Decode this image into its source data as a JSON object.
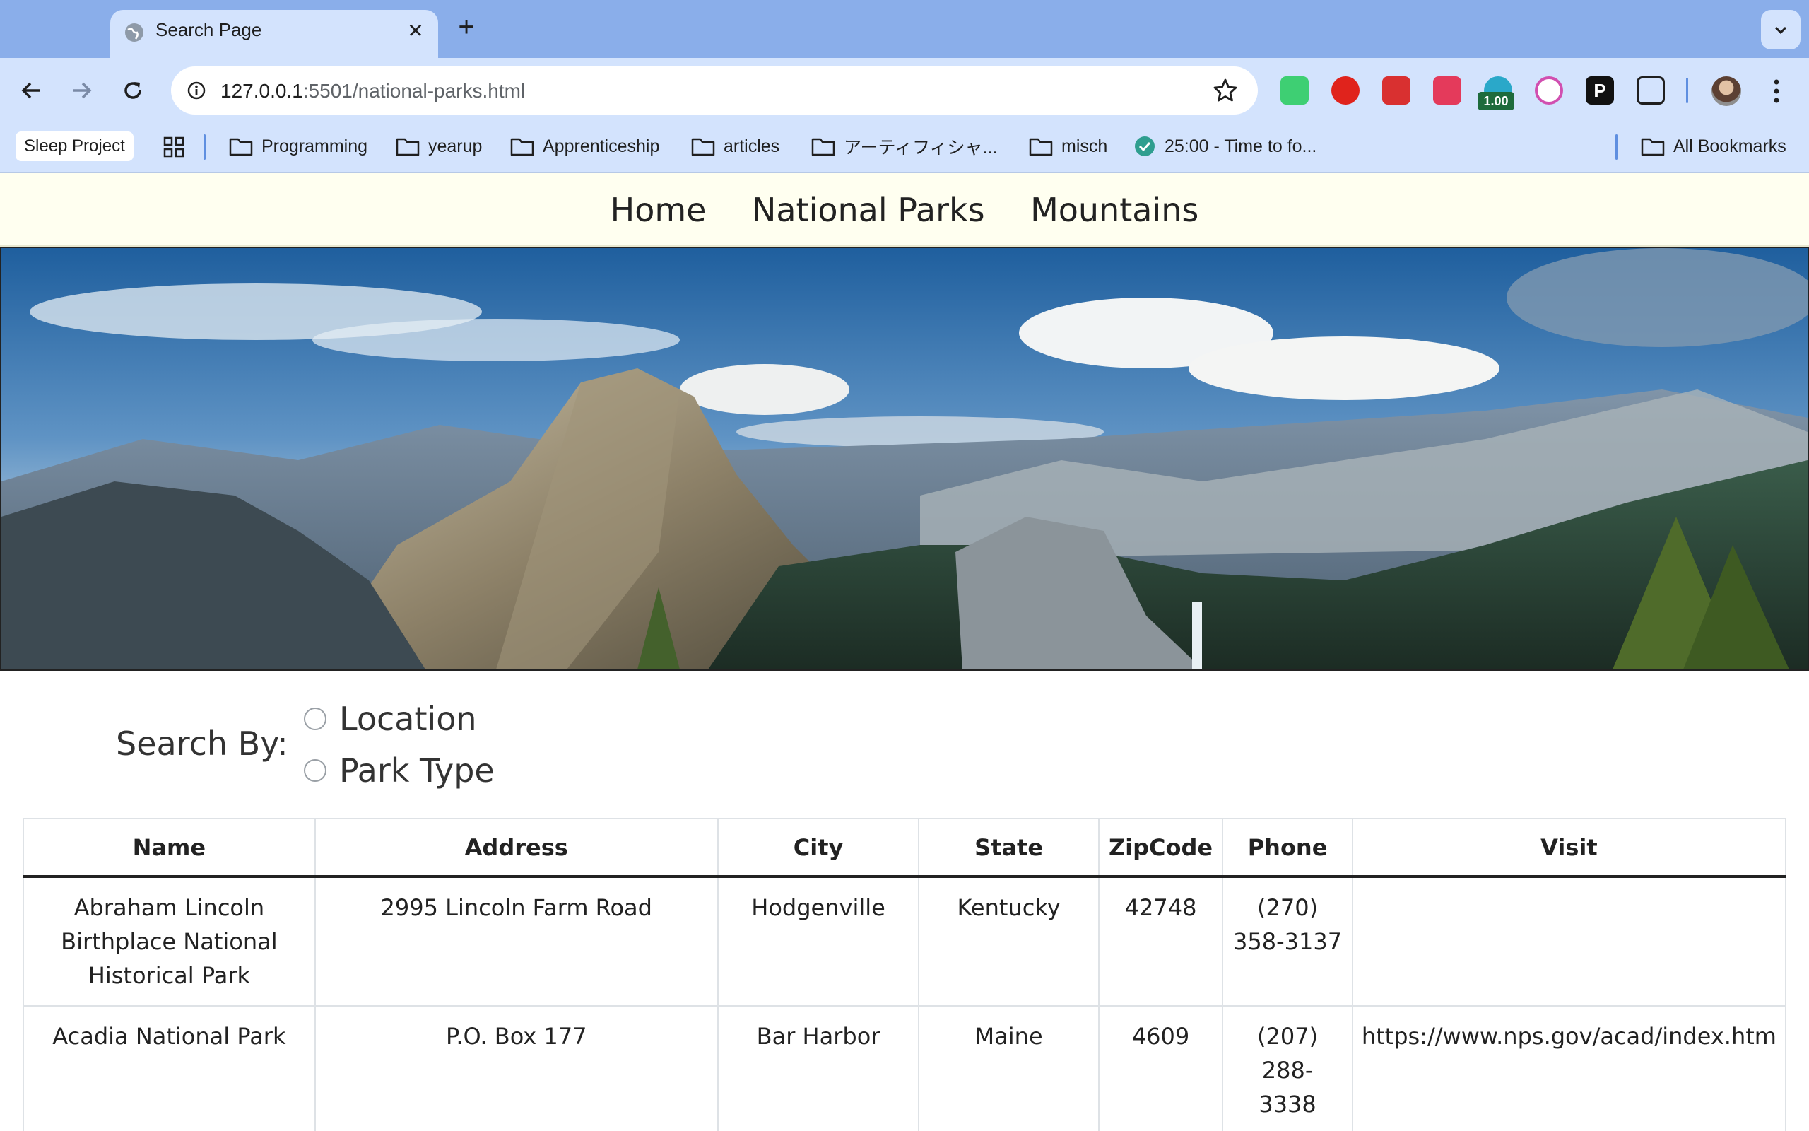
{
  "browser": {
    "tab_title": "Search Page",
    "url_host": "127.0.0.1",
    "url_path": ":5501/national-parks.html",
    "extension_badge": "1.00",
    "bookmarks": {
      "chip": "Sleep Project",
      "items": [
        "Programming",
        "yearup",
        "Apprenticeship",
        "articles",
        "アーティフィシャ...",
        "misch",
        "25:00 - Time to fo..."
      ],
      "all": "All Bookmarks"
    }
  },
  "site": {
    "nav": [
      "Home",
      "National Parks",
      "Mountains"
    ],
    "search_label": "Search By:",
    "search_options": [
      "Location",
      "Park Type"
    ]
  },
  "table": {
    "headers": [
      "Name",
      "Address",
      "City",
      "State",
      "ZipCode",
      "Phone",
      "Visit"
    ],
    "rows": [
      {
        "name": "Abraham Lincoln Birthplace National Historical Park",
        "address": "2995 Lincoln Farm Road",
        "city": "Hodgenville",
        "state": "Kentucky",
        "zip": "42748",
        "phone": "(270) 358-3137",
        "visit": ""
      },
      {
        "name": "Acadia National Park",
        "address": "P.O. Box 177",
        "city": "Bar Harbor",
        "state": "Maine",
        "zip": "4609",
        "phone": "(207) 288-3338",
        "visit": "https://www.nps.gov/acad/index.htm"
      }
    ]
  }
}
